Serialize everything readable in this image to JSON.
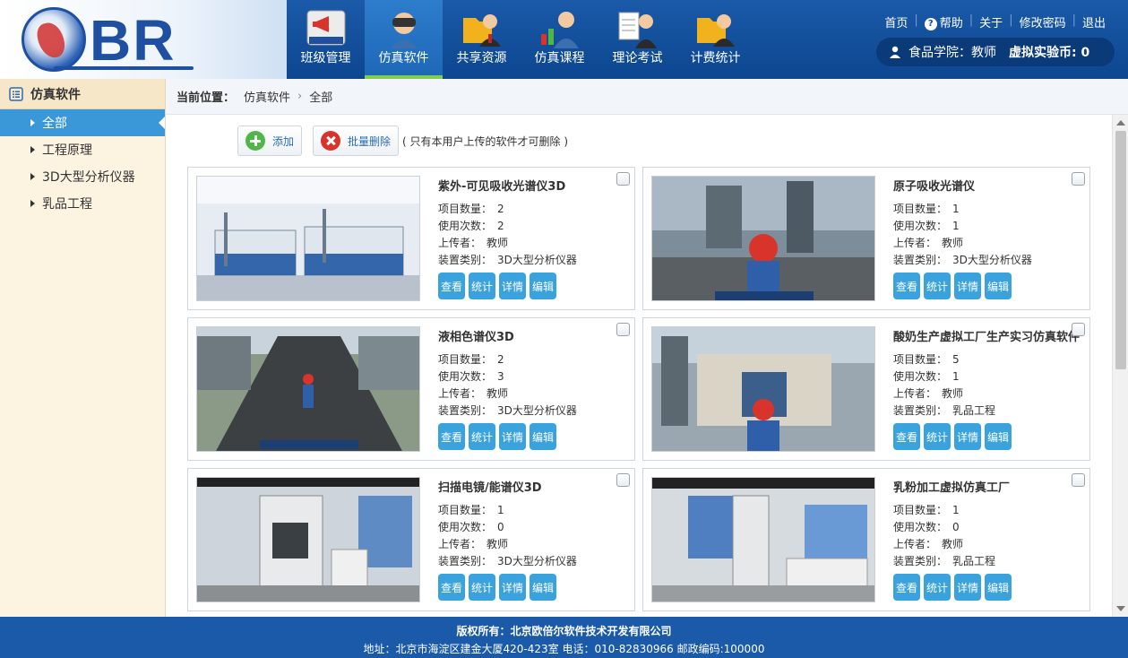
{
  "brand": {
    "logo_text": "BR"
  },
  "nav": {
    "items": [
      {
        "label": "班级管理",
        "icon": "announcement-icon"
      },
      {
        "label": "仿真软件",
        "icon": "vr-headset-icon"
      },
      {
        "label": "共享资源",
        "icon": "folder-user-icon"
      },
      {
        "label": "仿真课程",
        "icon": "chart-user-icon"
      },
      {
        "label": "理论考试",
        "icon": "exam-user-icon"
      },
      {
        "label": "计费统计",
        "icon": "folder-billing-icon"
      }
    ],
    "active": 1
  },
  "top_links": {
    "home": "首页",
    "help": "帮助",
    "about": "关于",
    "change_password": "修改密码",
    "logout": "退出"
  },
  "user": {
    "label": "食品学院：教师",
    "coins": "虚拟实验币: 0"
  },
  "sidebar": {
    "title": "仿真软件",
    "items": [
      {
        "label": "全部",
        "active": true
      },
      {
        "label": "工程原理"
      },
      {
        "label": "3D大型分析仪器"
      },
      {
        "label": "乳品工程"
      }
    ]
  },
  "breadcrumb": {
    "label": "当前位置：",
    "items": [
      "仿真软件",
      "全部"
    ]
  },
  "toolbar": {
    "add": "添加",
    "batch_delete": "批量删除",
    "note": "( 只有本用户上传的软件才可删除 )"
  },
  "field_labels": {
    "projects": "项目数量：",
    "uses": "使用次数：",
    "uploader": "上传者：",
    "category": "装置类别："
  },
  "action_labels": {
    "view": "查看",
    "stats": "统计",
    "detail": "详情",
    "edit": "编辑"
  },
  "cards": [
    {
      "title": "紫外-可见吸收光谱仪3D",
      "projects": "2",
      "uses": "2",
      "uploader": "教师",
      "category": "3D大型分析仪器"
    },
    {
      "title": "原子吸收光谱仪",
      "projects": "1",
      "uses": "1",
      "uploader": "教师",
      "category": "3D大型分析仪器"
    },
    {
      "title": "液相色谱仪3D",
      "projects": "2",
      "uses": "3",
      "uploader": "教师",
      "category": "3D大型分析仪器"
    },
    {
      "title": "酸奶生产虚拟工厂生产实习仿真软件",
      "projects": "5",
      "uses": "1",
      "uploader": "教师",
      "category": "乳品工程"
    },
    {
      "title": "扫描电镜/能谱仪3D",
      "projects": "1",
      "uses": "0",
      "uploader": "教师",
      "category": "3D大型分析仪器"
    },
    {
      "title": "乳粉加工虚拟仿真工厂",
      "projects": "1",
      "uses": "0",
      "uploader": "教师",
      "category": "乳品工程"
    }
  ],
  "footer": {
    "copyright": "版权所有：北京欧倍尔软件技术开发有限公司",
    "address": "地址：北京市海淀区建金大厦420-423室    电话：010-82830966    邮政编码:100000"
  },
  "colors": {
    "header": "#1a5aa8",
    "accent": "#3aa2dc",
    "sidebar_bg": "#fdf3e1",
    "nav_active_underline": "#7ed04b"
  }
}
